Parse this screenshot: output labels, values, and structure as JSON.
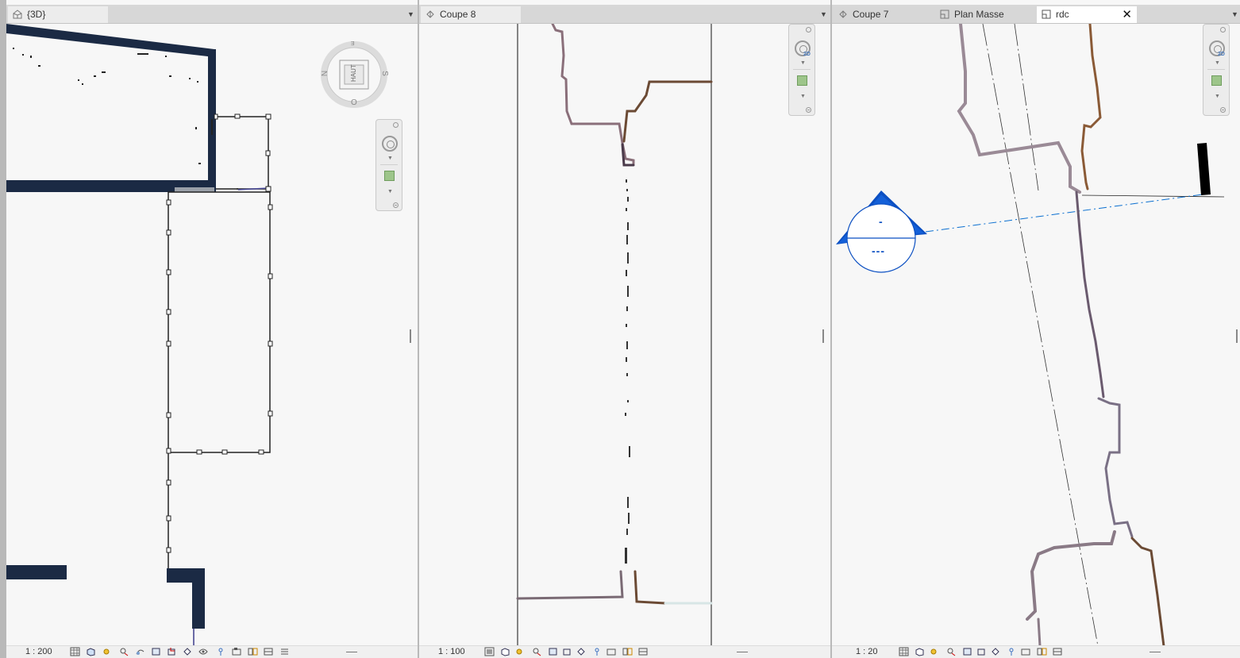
{
  "views": {
    "left": {
      "tab_label": "{3D}",
      "scale": "1 : 200",
      "viewcube": {
        "face": "HAUT",
        "compass": {
          "north": "N",
          "south": "S",
          "east": "E",
          "west": "O"
        }
      }
    },
    "middle": {
      "tab_label": "Coupe 8",
      "scale": "1 : 100"
    },
    "right": {
      "tabs": [
        "Coupe 7",
        "Plan Masse",
        "rdc"
      ],
      "active_tab": "rdc",
      "scale": "1 : 20",
      "section_head": {
        "top_text": "-",
        "bottom_text": "---"
      }
    }
  },
  "colors": {
    "wall_fill": "#1b2a44",
    "section_blue": "#0b4fc2",
    "pointcloud_brown": "#6b4a34",
    "background": "#f7f7f7"
  },
  "icons": {
    "navbar": [
      "steering-wheel-icon",
      "zoom-region-icon",
      "2d-wheel-icon"
    ],
    "statusbar": [
      "detail-level-icon",
      "visual-style-icon",
      "sun-path-icon",
      "shadows-icon",
      "render-icon",
      "crop-view-icon",
      "show-crop-icon",
      "temporary-hide-icon",
      "reveal-hidden-icon",
      "lock-view-icon",
      "analytical-model-icon",
      "highlight-displacement-icon",
      "reveal-constraints-icon"
    ]
  }
}
